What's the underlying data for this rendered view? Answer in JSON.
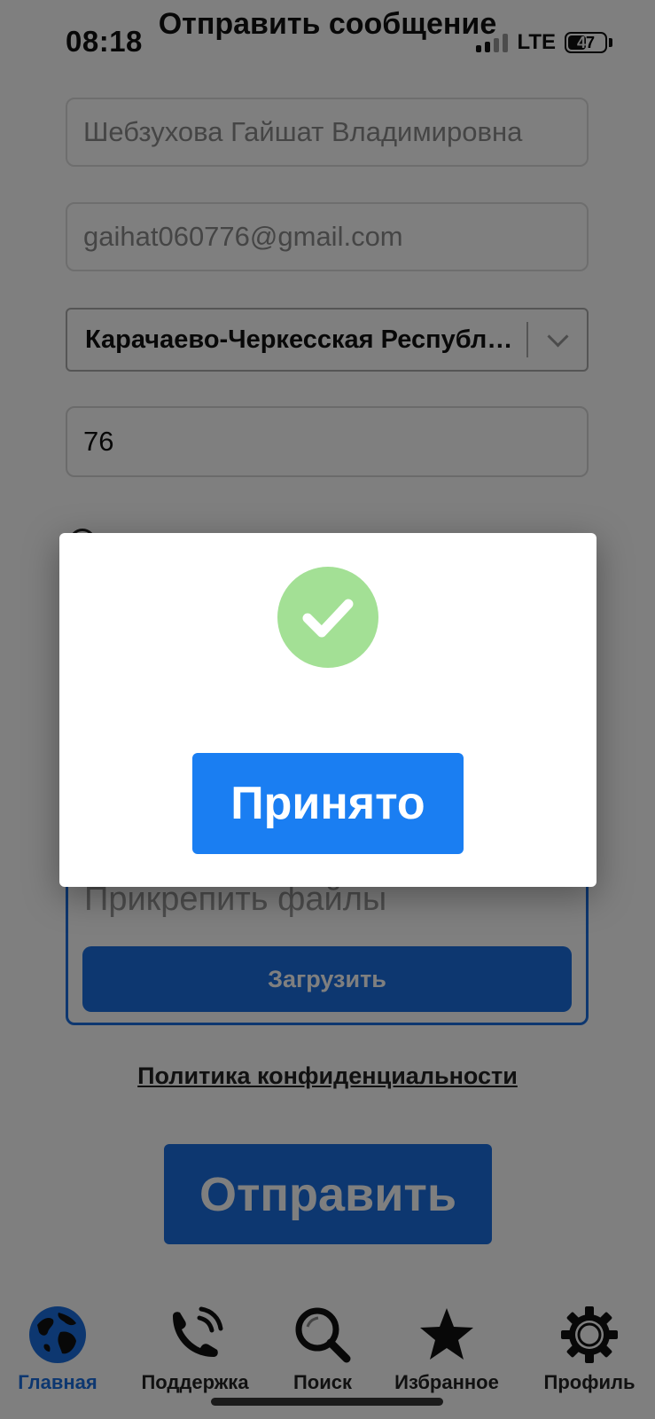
{
  "status_bar": {
    "time": "08:18",
    "network": "LTE",
    "battery": "47"
  },
  "page": {
    "title": "Отправить сообщение"
  },
  "form": {
    "name_value": "Шебзухова Гайшат Владимировна",
    "email_value": "gaihat060776@gmail.com",
    "region_value": "Карачаево-Черкесская Республика",
    "number_value": "76",
    "attach_label": "Прикрепить файлы",
    "upload_label": "Загрузить",
    "privacy_label": "Политика конфиденциальности",
    "send_label": "Отправить"
  },
  "tabs": [
    {
      "label": "Главная",
      "icon": "globe-icon",
      "active": true
    },
    {
      "label": "Поддержка",
      "icon": "phone-icon",
      "active": false
    },
    {
      "label": "Поиск",
      "icon": "search-icon",
      "active": false
    },
    {
      "label": "Избранное",
      "icon": "star-icon",
      "active": false
    },
    {
      "label": "Профиль",
      "icon": "gear-icon",
      "active": false
    }
  ],
  "modal": {
    "icon": "checkmark-icon",
    "confirm_label": "Принято"
  },
  "colors": {
    "accent": "#1a6fe0",
    "success": "#a3e095",
    "overlay": "rgba(0,0,0,0.5)"
  }
}
